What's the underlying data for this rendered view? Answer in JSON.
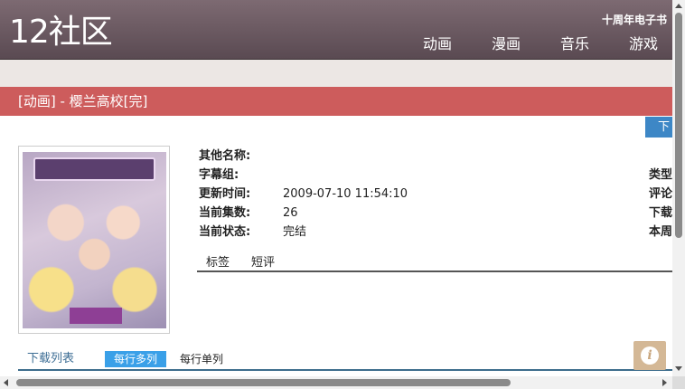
{
  "header": {
    "logo": "12社区",
    "anniversary_link": "十周年电子书",
    "nav": [
      "动画",
      "漫画",
      "音乐",
      "游戏"
    ]
  },
  "title_bar": {
    "title": "[动画] - 樱兰高校[完]"
  },
  "download_tab": "下",
  "info": {
    "rows": [
      {
        "label": "其他名称:",
        "value": ""
      },
      {
        "label": "字幕组:",
        "value": ""
      },
      {
        "label": "更新时间:",
        "value": "2009-07-10 11:54:10"
      },
      {
        "label": "当前集数:",
        "value": "26"
      },
      {
        "label": "当前状态:",
        "value": "完结"
      }
    ],
    "right_labels": [
      "类型",
      "评论",
      "下载",
      "本周"
    ]
  },
  "sub_tabs": [
    "标签",
    "短评"
  ],
  "list_bar": {
    "title": "下载列表",
    "multi_label": "每行多列",
    "single_label": "每行单列"
  },
  "info_button_glyph": "i",
  "colors": {
    "header_bg": "#6b5a62",
    "title_bar_bg": "#cd5c5c",
    "band_bg": "#ece7e4",
    "active_button": "#3aa0e8",
    "link": "#3d6e95"
  }
}
